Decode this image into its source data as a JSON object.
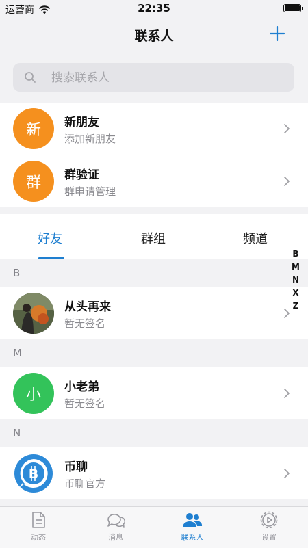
{
  "status_bar": {
    "carrier": "运营商",
    "time": "22:35"
  },
  "header": {
    "title": "联系人"
  },
  "search": {
    "placeholder": "搜索联系人"
  },
  "special_items": [
    {
      "avatar_text": "新",
      "name": "新朋友",
      "sub": "添加新朋友",
      "color": "#f5901e"
    },
    {
      "avatar_text": "群",
      "name": "群验证",
      "sub": "群申请管理",
      "color": "#f5901e"
    }
  ],
  "tabs": [
    {
      "label": "好友",
      "active": true
    },
    {
      "label": "群组",
      "active": false
    },
    {
      "label": "频道",
      "active": false
    }
  ],
  "sections": [
    {
      "letter": "B",
      "contact": {
        "name": "从头再来",
        "sub": "暂无签名",
        "avatar": "photo"
      }
    },
    {
      "letter": "M",
      "contact": {
        "name": "小老弟",
        "sub": "暂无签名",
        "avatar_text": "小",
        "color": "#33c35a"
      }
    },
    {
      "letter": "N",
      "contact": {
        "name": "币聊",
        "sub": "币聊官方",
        "avatar": "bitcoin-chat-logo",
        "color": "#2d8ad8"
      }
    }
  ],
  "alphabet_index": [
    "B",
    "M",
    "N",
    "X",
    "Z"
  ],
  "tab_bar": [
    {
      "label": "动态",
      "icon": "document-icon",
      "active": false
    },
    {
      "label": "消息",
      "icon": "chat-bubbles-icon",
      "active": false
    },
    {
      "label": "联系人",
      "icon": "contacts-icon",
      "active": true
    },
    {
      "label": "设置",
      "icon": "settings-icon",
      "active": false
    }
  ],
  "accent_color": "#1f7fd0"
}
